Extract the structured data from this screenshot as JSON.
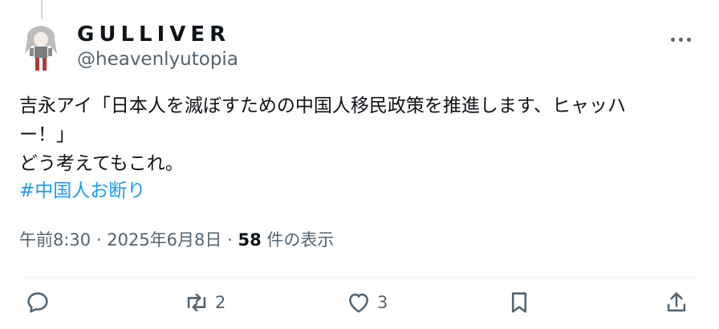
{
  "author": {
    "display_name": "GULLIVER",
    "handle": "@heavenlyutopia"
  },
  "tweet": {
    "text": "吉永アイ「日本人を滅ぼすための中国人移民政策を推進します、ヒャッハ\nー！」\nどう考えてもこれ。",
    "hashtag": "#中国人お断り"
  },
  "meta": {
    "time": "午前8:30",
    "separator": "·",
    "date": "2025年6月8日",
    "views_count": "58",
    "views_label": " 件の表示"
  },
  "actions": {
    "reply_icon": "reply-icon",
    "retweet_icon": "retweet-icon",
    "retweet_count": "2",
    "like_icon": "heart-icon",
    "like_count": "3",
    "bookmark_icon": "bookmark-icon",
    "share_icon": "share-icon"
  },
  "colors": {
    "link": "#1d9bf0",
    "secondary_text": "#536471",
    "primary_text": "#0f1419"
  }
}
